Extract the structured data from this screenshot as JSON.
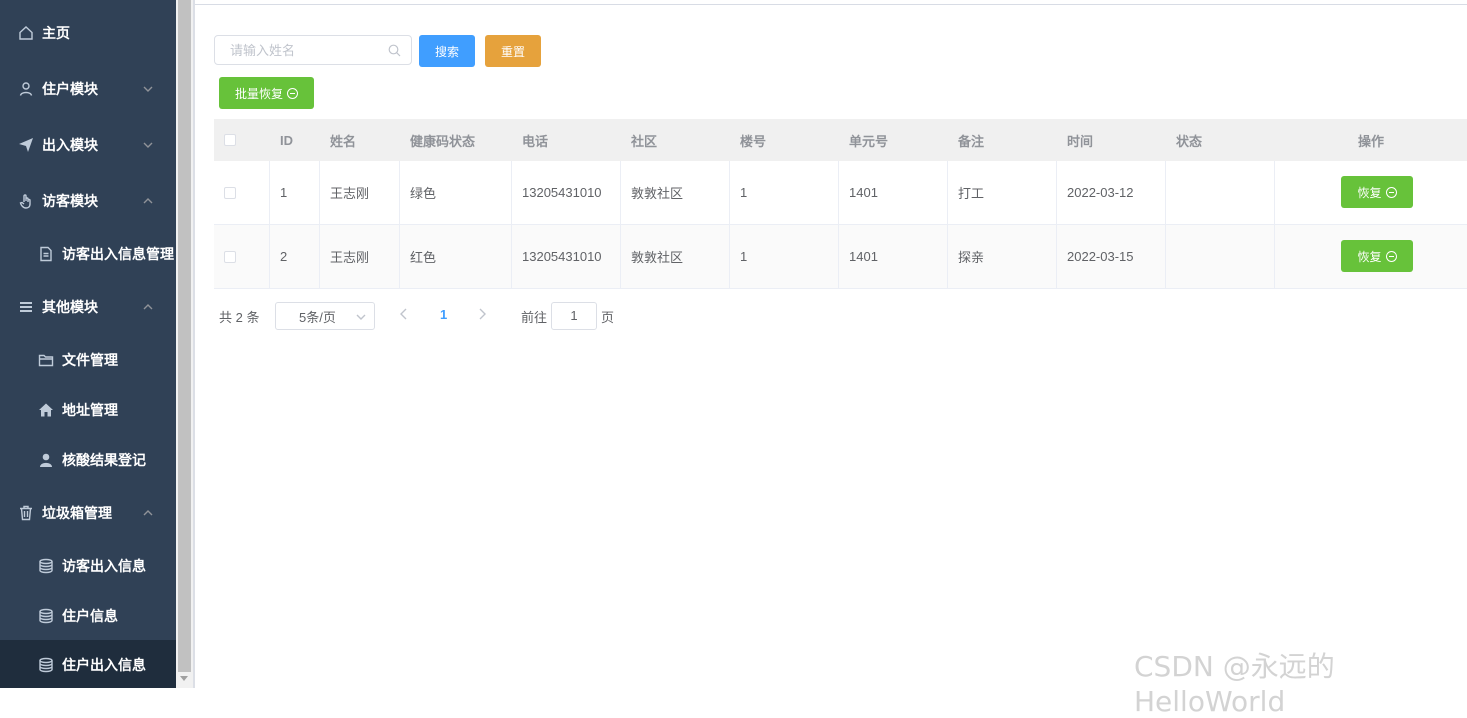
{
  "sidebar": {
    "items": [
      {
        "label": "主页",
        "icon": "home-icon"
      },
      {
        "label": "住户模块",
        "icon": "user-icon"
      },
      {
        "label": "出入模块",
        "icon": "send-icon"
      },
      {
        "label": "访客模块",
        "icon": "hand-icon"
      },
      {
        "label": "访客出入信息管理",
        "icon": "document-icon"
      },
      {
        "label": "其他模块",
        "icon": "menu-icon"
      },
      {
        "label": "文件管理",
        "icon": "folder-icon"
      },
      {
        "label": "地址管理",
        "icon": "house-icon"
      },
      {
        "label": "核酸结果登记",
        "icon": "person-stamp-icon"
      },
      {
        "label": "垃圾箱管理",
        "icon": "trash-icon"
      },
      {
        "label": "访客出入信息",
        "icon": "database-icon"
      },
      {
        "label": "住户信息",
        "icon": "database-icon"
      },
      {
        "label": "住户出入信息",
        "icon": "database-icon"
      }
    ]
  },
  "search": {
    "placeholder": "请输入姓名",
    "search_label": "搜索",
    "reset_label": "重置"
  },
  "batch_label": "批量恢复",
  "table": {
    "headers": [
      "ID",
      "姓名",
      "健康码状态",
      "电话",
      "社区",
      "楼号",
      "单元号",
      "备注",
      "时间",
      "状态",
      "操作"
    ],
    "rows": [
      [
        "1",
        "王志刚",
        "绿色",
        "13205431010",
        "敦敦社区",
        "1",
        "1401",
        "打工",
        "2022-03-12",
        ""
      ],
      [
        "2",
        "王志刚",
        "红色",
        "13205431010",
        "敦敦社区",
        "1",
        "1401",
        "探亲",
        "2022-03-15",
        ""
      ]
    ],
    "action_label": "恢复"
  },
  "pagination": {
    "total": "共 2 条",
    "page_size": "5条/页",
    "current": "1",
    "goto_prefix": "前往",
    "goto_value": "1",
    "goto_suffix": "页"
  },
  "watermark": "CSDN @永远的HelloWorld"
}
